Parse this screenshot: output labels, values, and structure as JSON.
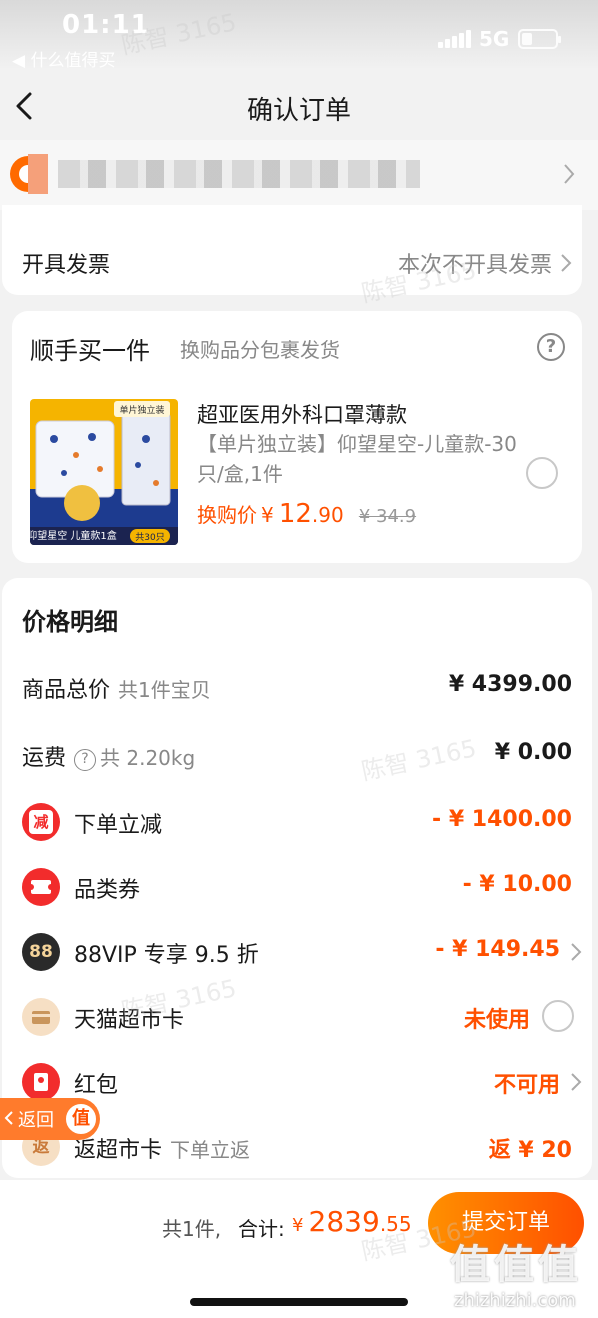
{
  "status": {
    "time": "01:11",
    "back_app": "◀ 什么值得买",
    "network": "5G"
  },
  "nav": {
    "title": "确认订单"
  },
  "invoice": {
    "label": "开具发票",
    "value": "本次不开具发票"
  },
  "addon": {
    "title": "顺手买一件",
    "subtitle": "换购品分包裹发货",
    "help": "?",
    "product": {
      "name": "超亚医用外科口罩薄款",
      "desc": "【单片独立装】仰望星空-儿童款-30只/盒,1件",
      "price_label": "换购价",
      "currency": "¥",
      "price_int": "12",
      "price_dec": ".90",
      "old_price": "¥ 34.9",
      "img_tag": "单片独立装",
      "img_caption": "仰望星空 儿童款1盒",
      "img_count": "共30只"
    }
  },
  "price_detail": {
    "title": "价格明细",
    "rows": [
      {
        "label": "商品总价",
        "sub": "共1件宝贝",
        "value": "¥ 4399.00"
      },
      {
        "label": "运费",
        "sub": "共 2.20kg",
        "value": "¥ 0.00"
      },
      {
        "label": "下单立减",
        "value": "- ¥ 1400.00",
        "icon_text": "减"
      },
      {
        "label": "品类券",
        "value": "- ¥ 10.00"
      },
      {
        "label": "88VIP 专享 9.5 折",
        "value": "- ¥ 149.45",
        "icon_text": "88"
      },
      {
        "label": "天猫超市卡",
        "value": "未使用"
      },
      {
        "label": "红包",
        "value": "不可用"
      },
      {
        "label": "返超市卡",
        "sub": "下单立返",
        "value": "返 ¥ 20",
        "icon_text": "返"
      }
    ]
  },
  "float_back": {
    "label": "返回",
    "logo": "值"
  },
  "bottom": {
    "count": "共1件,",
    "total_label": "合计:",
    "currency": "¥",
    "total_int": "2839",
    "total_dec": ".55",
    "submit": "提交订单"
  },
  "watermark": {
    "text": "陈智 3165",
    "site_logo": "值值值",
    "site_url": "zhizhizhi.com"
  },
  "colors": {
    "accent": "#ff5000",
    "background": "#f2f2f2"
  }
}
